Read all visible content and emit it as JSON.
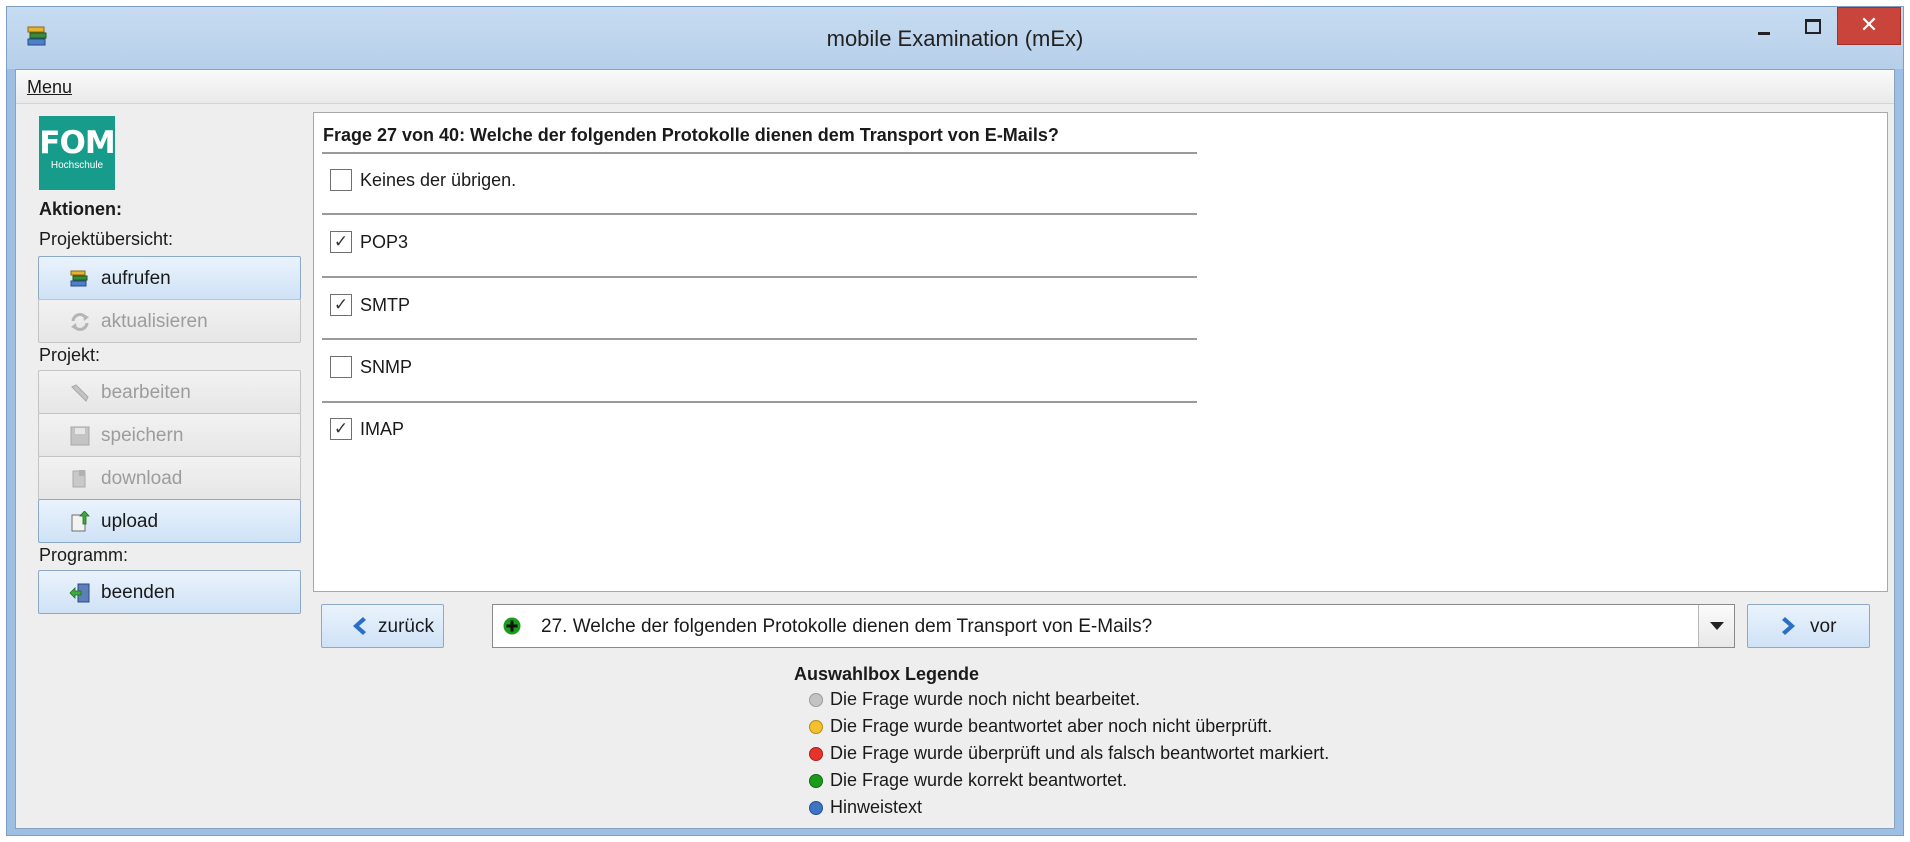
{
  "window": {
    "title": "mobile Examination (mEx)",
    "close_glyph": "✕"
  },
  "menubar": {
    "menu_label": "Menu"
  },
  "sidebar": {
    "logo_text": "FOM",
    "logo_subtext": "Hochschule",
    "heading": "Aktionen:",
    "group_projektuebersicht": "Projektübersicht:",
    "group_projekt": "Projekt:",
    "group_programm": "Programm:",
    "buttons": {
      "aufrufen": "aufrufen",
      "aktualisieren": "aktualisieren",
      "bearbeiten": "bearbeiten",
      "speichern": "speichern",
      "download": "download",
      "upload": "upload",
      "beenden": "beenden"
    }
  },
  "question": {
    "title": "Frage 27 von 40: Welche der folgenden Protokolle dienen dem Transport von E-Mails?",
    "options": [
      {
        "label": "Keines der übrigen.",
        "mark": ""
      },
      {
        "label": "POP3",
        "mark": "✓"
      },
      {
        "label": "SMTP",
        "mark": "✓"
      },
      {
        "label": "SNMP",
        "mark": ""
      },
      {
        "label": "IMAP",
        "mark": "✓"
      }
    ]
  },
  "navigation": {
    "back_label": "zurück",
    "next_label": "vor",
    "combo_text": "27. Welche der folgenden Protokolle dienen dem Transport von E-Mails?",
    "combo_status": "correct"
  },
  "legend": {
    "title": "Auswahlbox Legende",
    "items": [
      {
        "text": "Die Frage wurde noch nicht bearbeitet.",
        "color": "#c3c3c3"
      },
      {
        "text": "Die Frage wurde beantwortet aber noch nicht überprüft.",
        "color": "#f2c12e"
      },
      {
        "text": "Die Frage wurde überprüft und als falsch beantwortet markiert.",
        "color": "#e8322b"
      },
      {
        "text": "Die Frage wurde korrekt beantwortet.",
        "color": "#1a9b1a"
      },
      {
        "text": "Hinweistext",
        "color": "#3f73c4"
      }
    ]
  }
}
